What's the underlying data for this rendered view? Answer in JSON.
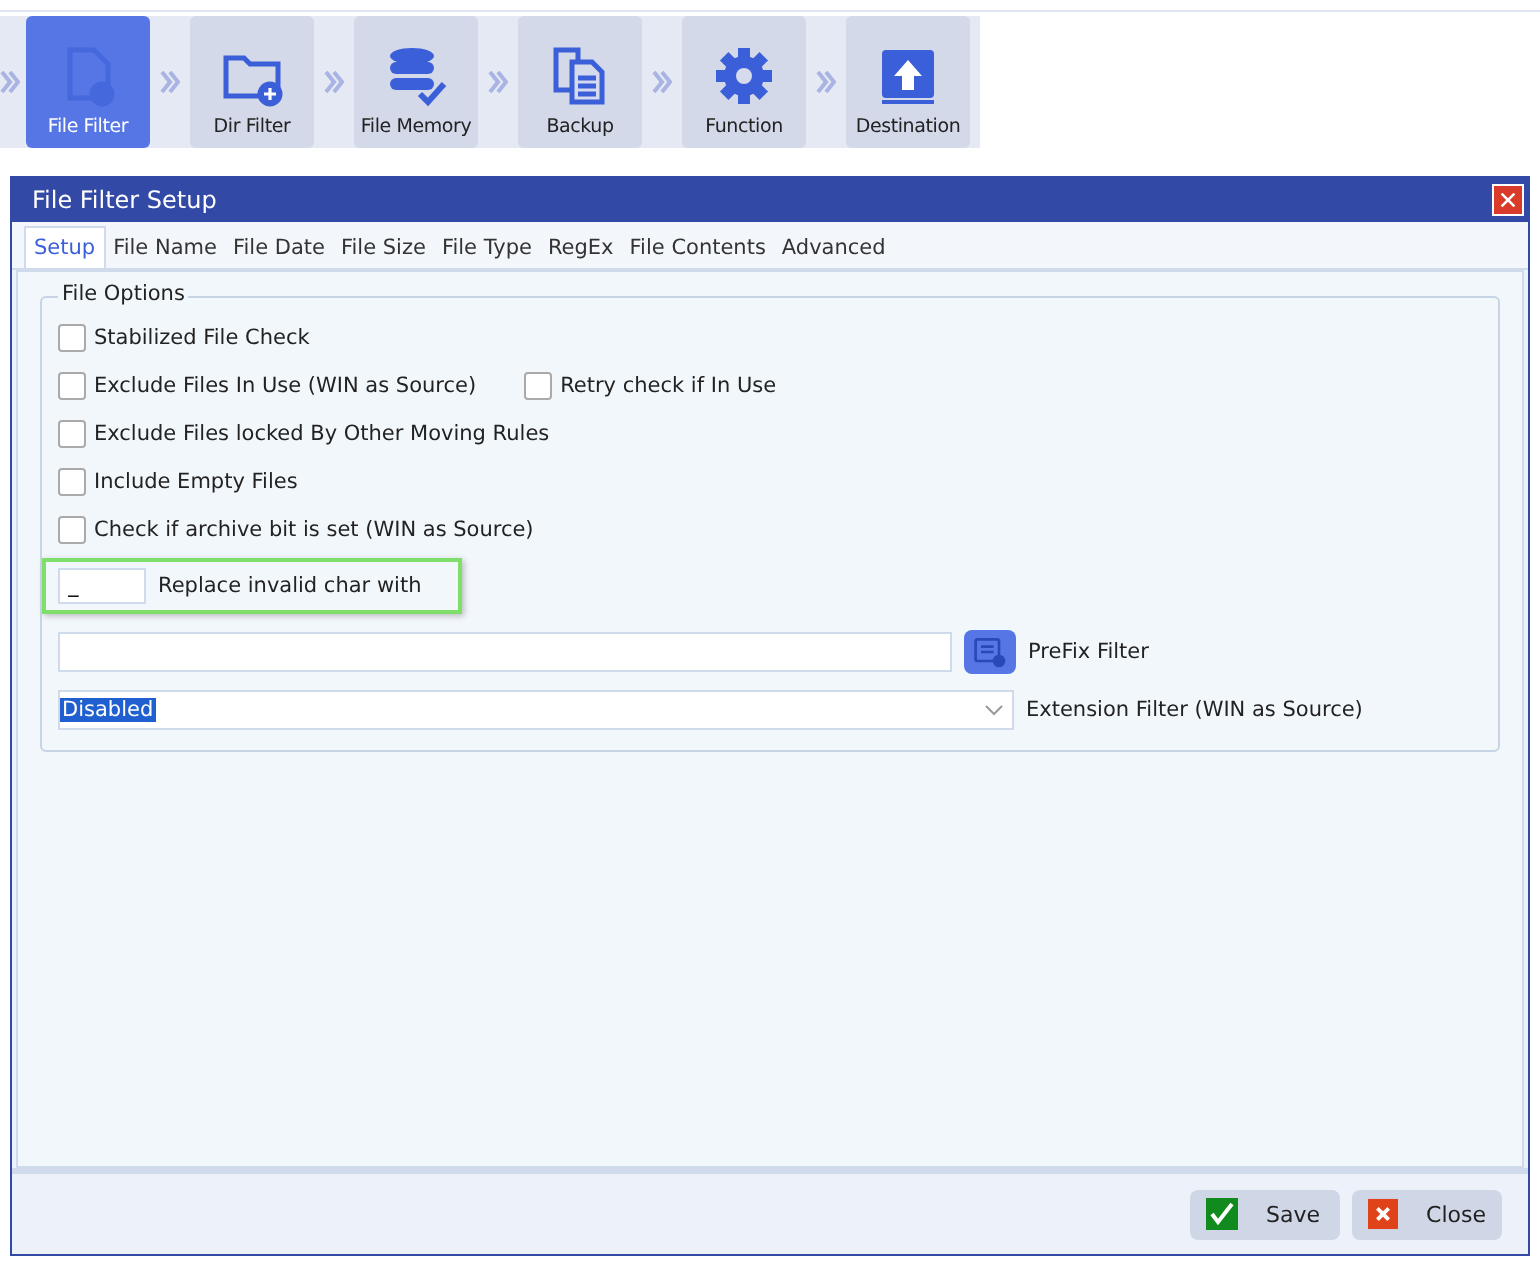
{
  "toolbar": [
    {
      "label": "File Filter",
      "kind": "file",
      "selected": true
    },
    {
      "label": "Dir Filter",
      "kind": "folder",
      "selected": false
    },
    {
      "label": "File Memory",
      "kind": "database",
      "selected": false
    },
    {
      "label": "Backup",
      "kind": "copy",
      "selected": false
    },
    {
      "label": "Function",
      "kind": "gear",
      "selected": false
    },
    {
      "label": "Destination",
      "kind": "upload",
      "selected": false
    }
  ],
  "dialog": {
    "title": "File Filter Setup",
    "tabs": [
      {
        "label": "Setup",
        "selected": true
      },
      {
        "label": "File Name",
        "selected": false
      },
      {
        "label": "File Date",
        "selected": false
      },
      {
        "label": "File Size",
        "selected": false
      },
      {
        "label": "File Type",
        "selected": false
      },
      {
        "label": "RegEx",
        "selected": false
      },
      {
        "label": "File Contents",
        "selected": false
      },
      {
        "label": "Advanced",
        "selected": false
      }
    ],
    "group_title": "File Options",
    "option_rows": [
      [
        {
          "label": "Stabilized File Check",
          "checked": false
        }
      ],
      [
        {
          "label": "Exclude Files In Use (WIN as Source)",
          "checked": false
        },
        {
          "label": "Retry check if In Use",
          "checked": false
        }
      ],
      [
        {
          "label": "Exclude Files locked By Other Moving Rules",
          "checked": false
        }
      ],
      [
        {
          "label": "Include Empty Files",
          "checked": false
        }
      ],
      [
        {
          "label": "Check if archive bit is set (WIN as Source)",
          "checked": false
        }
      ]
    ],
    "replace_char": {
      "value": "_",
      "label": "Replace invalid char with"
    },
    "prefix_filter": {
      "label": "PreFix Filter"
    },
    "extension_filter": {
      "value": "Disabled",
      "label": "Extension Filter (WIN as Source)"
    },
    "buttons": [
      {
        "label": "Save",
        "kind": "save"
      },
      {
        "label": "Close",
        "kind": "close"
      }
    ]
  }
}
